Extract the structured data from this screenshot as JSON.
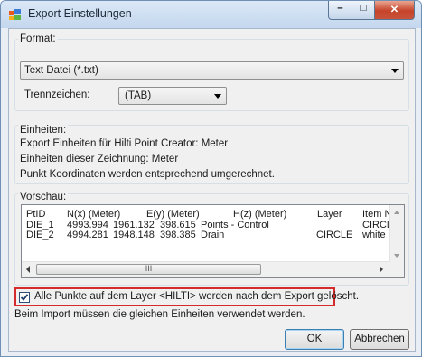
{
  "window": {
    "title": "Export Einstellungen",
    "close_glyph": "✕",
    "min_glyph": "–",
    "max_glyph": "□"
  },
  "format": {
    "label": "Format:",
    "selected": "Text Datei (*.txt)",
    "separator_label": "Trennzeichen:",
    "separator_selected": "(TAB)"
  },
  "units": {
    "label": "Einheiten:",
    "line1": "Export Einheiten für Hilti Point Creator: Meter",
    "line2": "Einheiten dieser Zeichnung: Meter",
    "line3": "Punkt Koordinaten werden entsprechend umgerechnet."
  },
  "preview": {
    "label": "Vorschau:",
    "headers": [
      "PtID",
      "N(x) (Meter)",
      "E(y) (Meter)",
      "H(z) (Meter)",
      "Layer",
      "Item Nc"
    ],
    "rows": [
      [
        "DIE_1",
        "4993.994",
        "1961.132",
        "398.615",
        "Points - Control",
        "",
        "CIRCLE"
      ],
      [
        "DIE_2",
        "4994.281",
        "1948.148",
        "398.385",
        "Drain",
        "CIRCLE",
        "white"
      ]
    ],
    "scroll_thumb_glyph": "III"
  },
  "options": {
    "delete_checkbox_label": "Alle Punkte auf dem Layer <HILTI> werden nach dem Export gelöscht.",
    "delete_checked": true,
    "import_note": "Beim Import müssen die gleichen Einheiten verwendet werden."
  },
  "buttons": {
    "ok": "OK",
    "cancel": "Abbrechen"
  },
  "colors": {
    "highlight_border": "#d42a2a",
    "title_gradient_top": "#dbe8f7",
    "close_button": "#c5432a"
  }
}
